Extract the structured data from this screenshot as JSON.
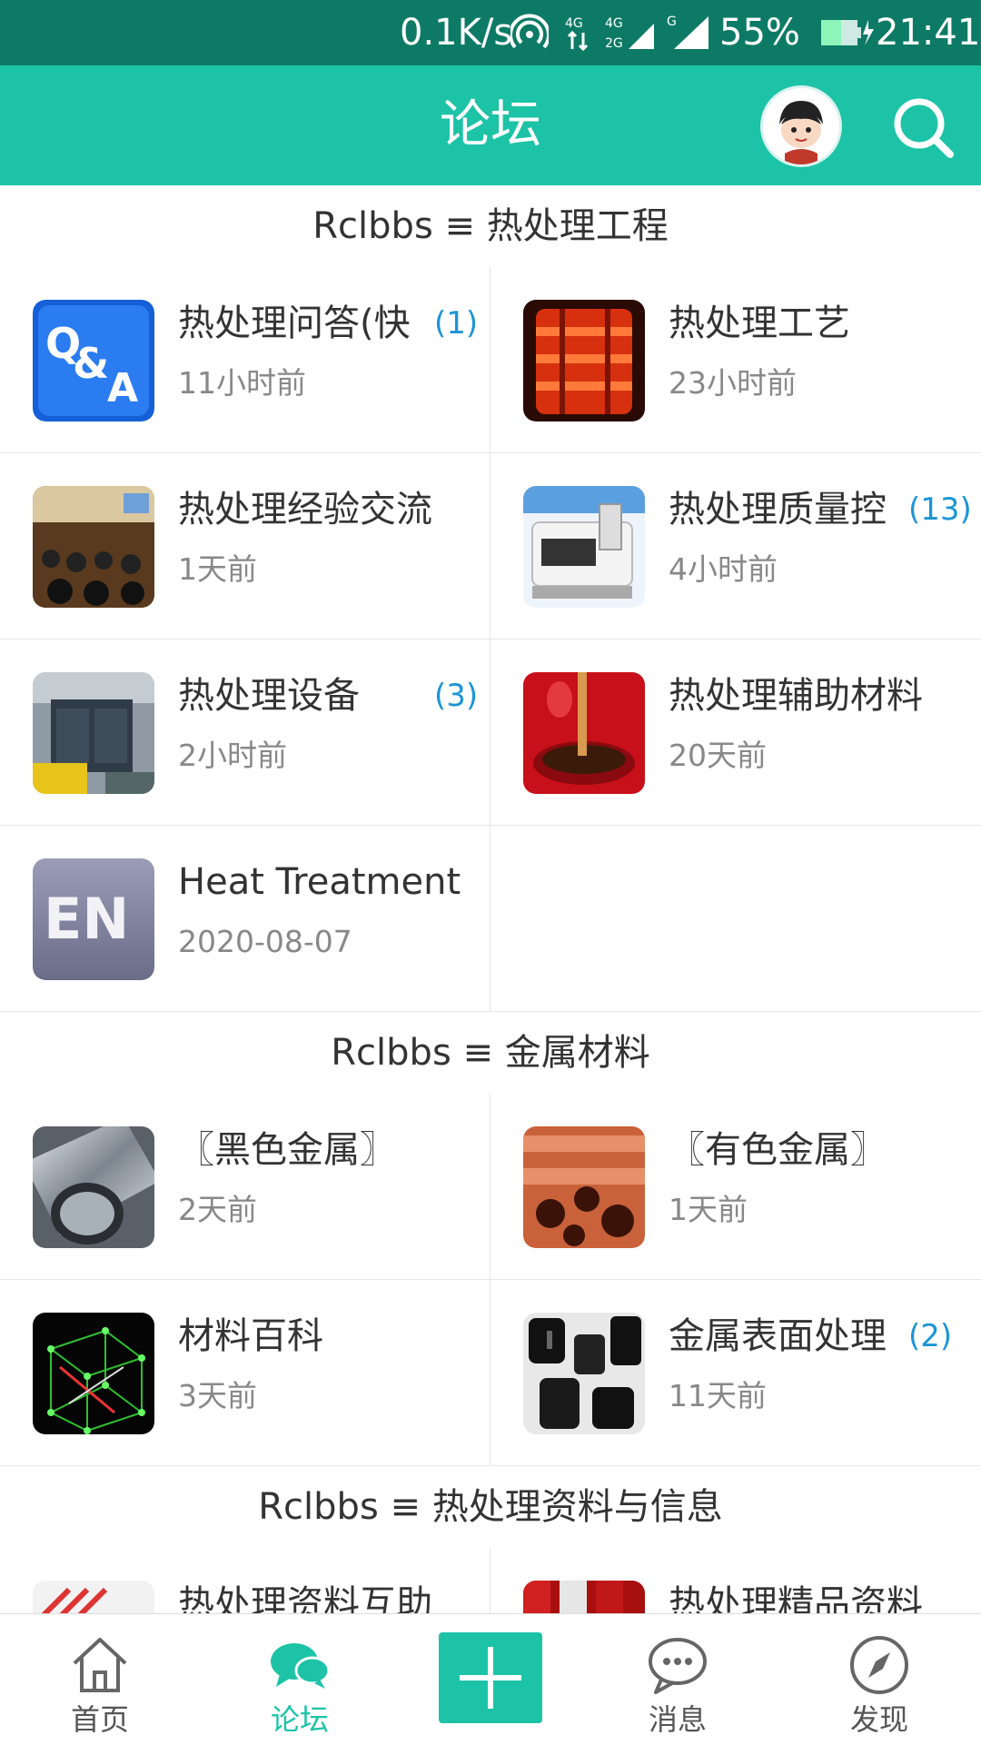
{
  "status_bar": {
    "speed": "0.1K/s",
    "battery_percent": "55%",
    "time": "21:41"
  },
  "header": {
    "title": "论坛"
  },
  "sections": [
    {
      "title": "Rclbbs ≡ 热处理工程",
      "forums": [
        {
          "title": "热处理问答(快",
          "time": "11小时前",
          "count": "(1)",
          "icon": "qa-icon"
        },
        {
          "title": "热处理工艺",
          "time": "23小时前",
          "count": "",
          "icon": "furnace-icon"
        },
        {
          "title": "热处理经验交流",
          "time": "1天前",
          "count": "",
          "icon": "meeting-icon"
        },
        {
          "title": "热处理质量控",
          "time": "4小时前",
          "count": "(13)",
          "icon": "microscope-icon"
        },
        {
          "title": "热处理设备",
          "time": "2小时前",
          "count": "(3)",
          "icon": "equipment-icon"
        },
        {
          "title": "热处理辅助材料",
          "time": "20天前",
          "count": "",
          "icon": "oil-icon"
        },
        {
          "title": "Heat Treatment",
          "time": "2020-08-07",
          "count": "",
          "icon": "en-icon"
        }
      ]
    },
    {
      "title": "Rclbbs ≡ 金属材料",
      "forums": [
        {
          "title": "〖黑色金属〗",
          "time": "2天前",
          "count": "",
          "icon": "steel-pipe-icon"
        },
        {
          "title": "〖有色金属〗",
          "time": "1天前",
          "count": "",
          "icon": "copper-pipe-icon"
        },
        {
          "title": "材料百科",
          "time": "3天前",
          "count": "",
          "icon": "crystal-lattice-icon"
        },
        {
          "title": "金属表面处理",
          "time": "11天前",
          "count": "(2)",
          "icon": "fastener-icon"
        }
      ]
    },
    {
      "title": "Rclbbs ≡ 热处理资料与信息",
      "forums": [
        {
          "title": "热处理资料互助",
          "time": "",
          "count": "",
          "icon": "docs-icon"
        },
        {
          "title": "热处理精品资料",
          "time": "",
          "count": "",
          "icon": "books-icon"
        }
      ]
    }
  ],
  "bottom_nav": {
    "items": [
      {
        "label": "首页",
        "icon": "home-icon",
        "active": false
      },
      {
        "label": "论坛",
        "icon": "chat-bubbles-icon",
        "active": true
      },
      {
        "label": "",
        "icon": "plus-icon",
        "active": false
      },
      {
        "label": "消息",
        "icon": "message-icon",
        "active": false
      },
      {
        "label": "发现",
        "icon": "compass-icon",
        "active": false
      }
    ]
  },
  "colors": {
    "primary": "#1cc3a6",
    "status_bar": "#0d7a66",
    "count": "#1c95d6"
  }
}
